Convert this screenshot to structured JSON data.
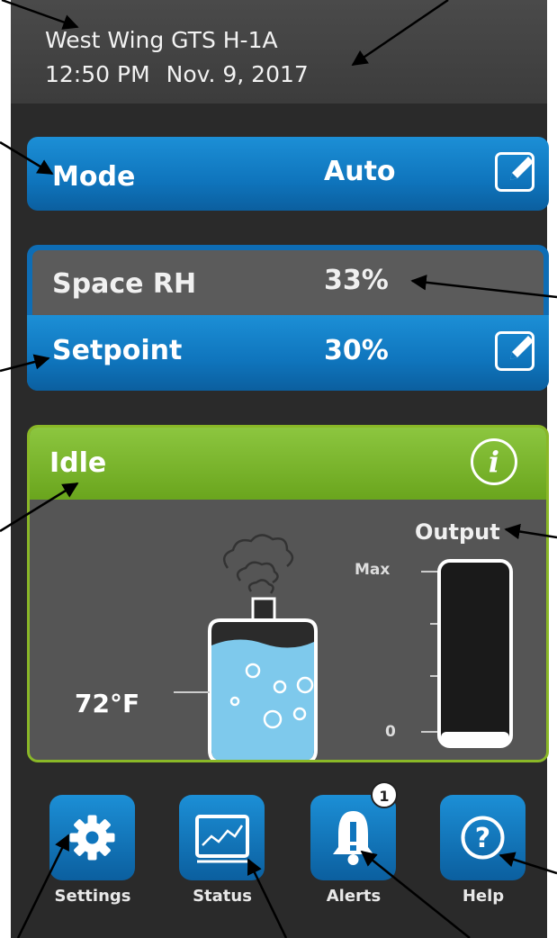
{
  "header": {
    "location": "West Wing GTS H-1A",
    "time": "12:50 PM",
    "date": "Nov. 9, 2017"
  },
  "mode": {
    "label": "Mode",
    "value": "Auto",
    "edit_icon": "edit-icon"
  },
  "humidity": {
    "space_label": "Space RH",
    "space_value": "33%",
    "setpoint_label": "Setpoint",
    "setpoint_value": "30%",
    "edit_icon": "edit-icon"
  },
  "status_panel": {
    "state": "Idle",
    "info_icon": "info-icon",
    "info_glyph": "i",
    "output_label": "Output",
    "output_level": 0,
    "meter_max_label": "Max",
    "meter_min_label": "0",
    "water_temp": "72°F"
  },
  "nav": {
    "items": [
      {
        "label": "Settings",
        "icon": "gear-icon"
      },
      {
        "label": "Status",
        "icon": "chart-icon"
      },
      {
        "label": "Alerts",
        "icon": "bell-icon",
        "badge": "1"
      },
      {
        "label": "Help",
        "icon": "question-icon"
      }
    ]
  },
  "colors": {
    "accent_blue": "#0f75bd",
    "status_green": "#7ab929",
    "panel_gray": "#555555"
  }
}
